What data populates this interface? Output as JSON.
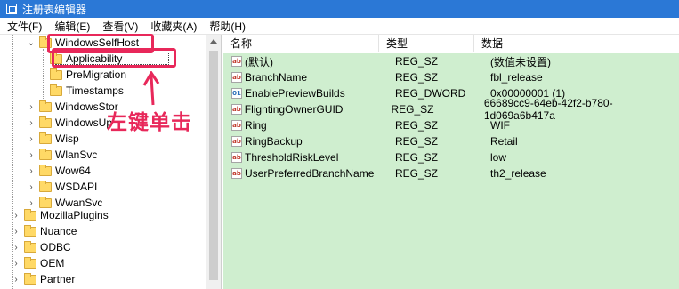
{
  "window": {
    "title": "注册表编辑器"
  },
  "menu": [
    "文件(F)",
    "编辑(E)",
    "查看(V)",
    "收藏夹(A)",
    "帮助(H)"
  ],
  "tree": {
    "items": [
      {
        "label": "WindowsSelfHost",
        "expander": "⌄"
      },
      {
        "label": "Applicability",
        "expander": ""
      },
      {
        "label": "PreMigration",
        "expander": ""
      },
      {
        "label": "Timestamps",
        "expander": ""
      },
      {
        "label": "WindowsStor",
        "expander": "›"
      },
      {
        "label": "WindowsUp",
        "expander": "›"
      },
      {
        "label": "Wisp",
        "expander": "›"
      },
      {
        "label": "WlanSvc",
        "expander": "›"
      },
      {
        "label": "Wow64",
        "expander": "›"
      },
      {
        "label": "WSDAPI",
        "expander": "›"
      },
      {
        "label": "WwanSvc",
        "expander": "›"
      },
      {
        "label": "MozillaPlugins",
        "expander": "›"
      },
      {
        "label": "Nuance",
        "expander": "›"
      },
      {
        "label": "ODBC",
        "expander": "›"
      },
      {
        "label": "OEM",
        "expander": "›"
      },
      {
        "label": "Partner",
        "expander": "›"
      }
    ]
  },
  "annotation": {
    "text": "左键单击",
    "color": "#e8285a"
  },
  "columns": {
    "name": "名称",
    "type": "类型",
    "data": "数据"
  },
  "values": [
    {
      "icon": "ab",
      "name": "(默认)",
      "type": "REG_SZ",
      "data": "(数值未设置)"
    },
    {
      "icon": "ab",
      "name": "BranchName",
      "type": "REG_SZ",
      "data": "fbl_release"
    },
    {
      "icon": "bin",
      "name": "EnablePreviewBuilds",
      "type": "REG_DWORD",
      "data": "0x00000001 (1)"
    },
    {
      "icon": "ab",
      "name": "FlightingOwnerGUID",
      "type": "REG_SZ",
      "data": "66689cc9-64eb-42f2-b780-1d069a6b417a"
    },
    {
      "icon": "ab",
      "name": "Ring",
      "type": "REG_SZ",
      "data": "WIF"
    },
    {
      "icon": "ab",
      "name": "RingBackup",
      "type": "REG_SZ",
      "data": "Retail"
    },
    {
      "icon": "ab",
      "name": "ThresholdRiskLevel",
      "type": "REG_SZ",
      "data": "low"
    },
    {
      "icon": "ab",
      "name": "UserPreferredBranchName",
      "type": "REG_SZ",
      "data": "th2_release"
    }
  ]
}
